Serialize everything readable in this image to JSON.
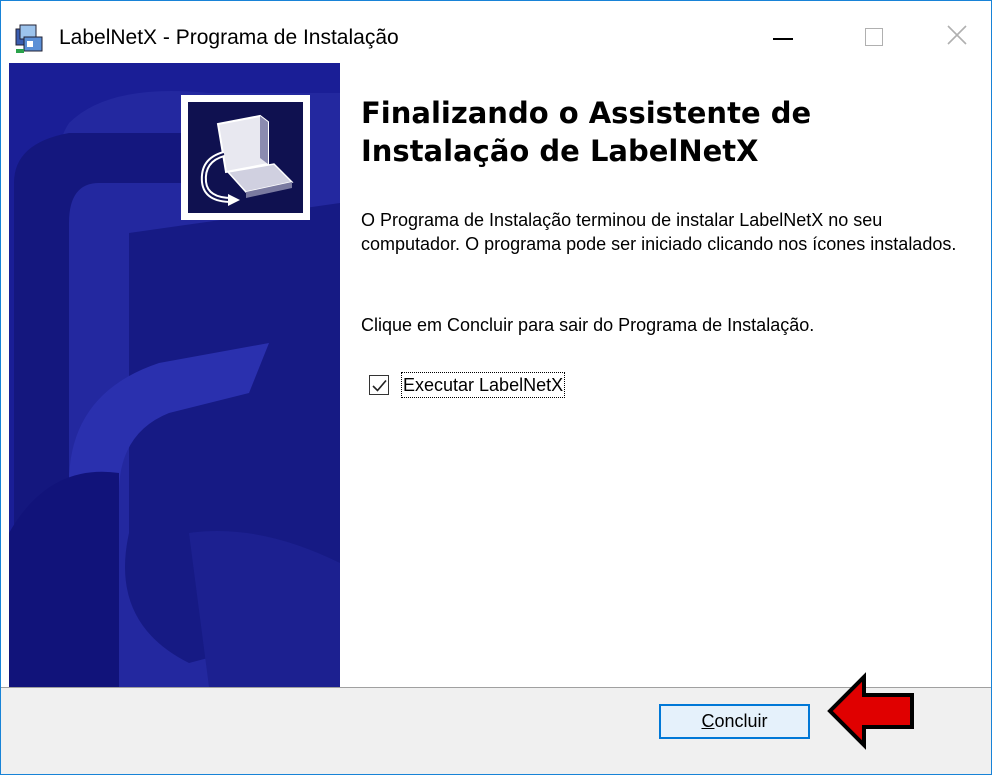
{
  "window": {
    "title": "LabelNetX - Programa de Instalação",
    "app_icon": "installer-icon",
    "controls": [
      "minimize-icon",
      "maximize-icon",
      "close-icon"
    ]
  },
  "wizard": {
    "heading_line1": "Finalizando o Assistente de",
    "heading_line2": "Instalação de LabelNetX",
    "paragraph1": "O Programa de Instalação terminou de instalar LabelNetX no seu computador. O programa pode ser iniciado clicando nos ícones instalados.",
    "paragraph2": "Clique em Concluir para sair do Programa de Instalação.",
    "run_checkbox": {
      "label": "Executar LabelNetX",
      "checked": true
    },
    "logo_icon": "computer-install-icon"
  },
  "footer": {
    "finish_button_label": "Concluir",
    "annotation_icon": "red-arrow-icon"
  },
  "colors": {
    "wizard_image_bg": "#1a1e96",
    "window_border": "#1883d7",
    "focused_button_border": "#0078d7",
    "annotation_arrow": "#e00000"
  }
}
